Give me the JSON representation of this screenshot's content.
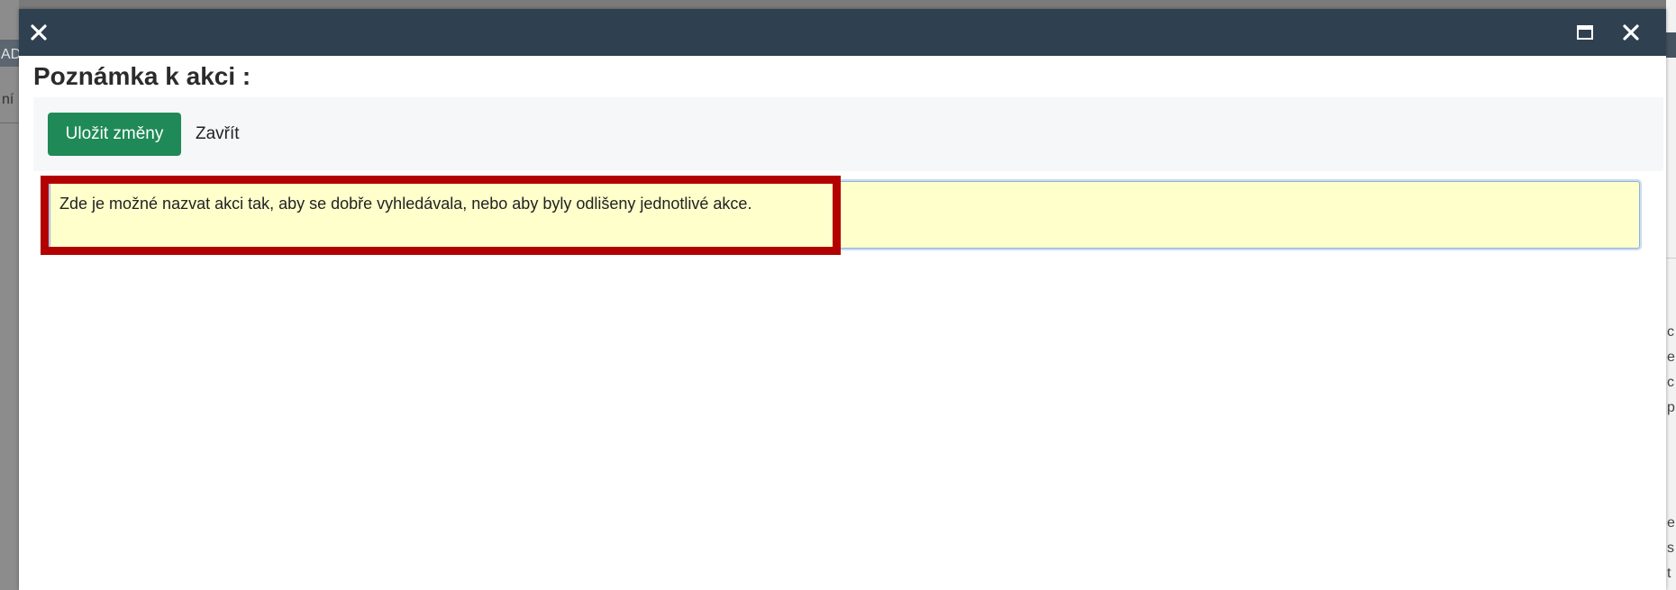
{
  "dialog": {
    "title": "Poznámka k akci :",
    "close_icon": "close-icon",
    "maximize_icon": "maximize-icon"
  },
  "toolbar": {
    "save_label": "Uložit změny",
    "close_label": "Zavřít"
  },
  "note": {
    "value": "Zde je možné nazvat akci tak, aby se dobře vyhledávala, nebo aby byly odlišeny jednotlivé akce."
  },
  "background": {
    "left_fragment_top": "AD",
    "left_fragment_mid": "ní",
    "right_letters": [
      "c",
      "e",
      "c",
      "p",
      "e",
      "s",
      "t"
    ]
  },
  "colors": {
    "titlebar": "#2f4050",
    "save_button": "#1f8a57",
    "note_background": "#ffffcc",
    "highlight": "#b30000"
  }
}
